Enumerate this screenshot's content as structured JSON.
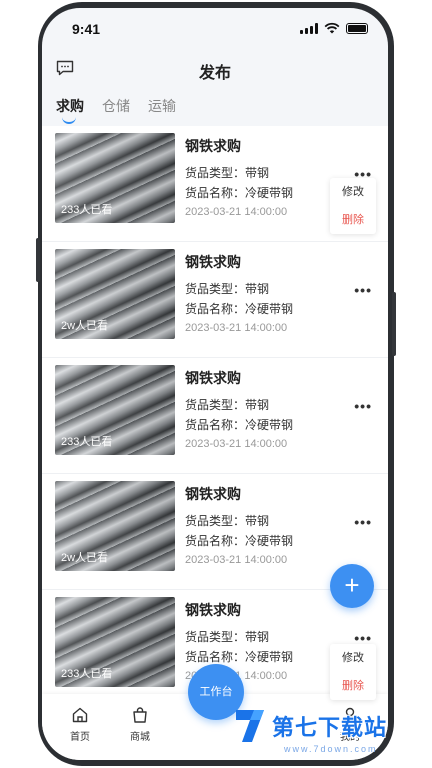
{
  "status": {
    "time": "9:41"
  },
  "header": {
    "title": "发布",
    "message_icon": "message-icon"
  },
  "tabs": [
    {
      "label": "求购",
      "active": true
    },
    {
      "label": "仓储",
      "active": false
    },
    {
      "label": "运输",
      "active": false
    }
  ],
  "posts": [
    {
      "title": "钢铁求购",
      "type": "货品类型：带钢",
      "name": "货品名称：冷硬带钢",
      "date": "2023-03-21  14:00:00",
      "views": "233人已看"
    },
    {
      "title": "钢铁求购",
      "type": "货品类型：带钢",
      "name": "货品名称：冷硬带钢",
      "date": "2023-03-21  14:00:00",
      "views": "2w人已看"
    },
    {
      "title": "钢铁求购",
      "type": "货品类型：带钢",
      "name": "货品名称：冷硬带钢",
      "date": "2023-03-21  14:00:00",
      "views": "233人已看"
    },
    {
      "title": "钢铁求购",
      "type": "货品类型：带钢",
      "name": "货品名称：冷硬带钢",
      "date": "2023-03-21  14:00:00",
      "views": "2w人已看"
    },
    {
      "title": "钢铁求购",
      "type": "货品类型：带钢",
      "name": "货品名称：冷硬带钢",
      "date": "2023-03-21  14:00:00",
      "views": "233人已看"
    }
  ],
  "more_label": "•••",
  "popup": {
    "edit": "修改",
    "delete": "删除"
  },
  "fab": {
    "icon": "plus-icon",
    "label": "+"
  },
  "tabbar": {
    "home": "首页",
    "mall": "商城",
    "workbench": "工作台",
    "mine": "我的"
  },
  "watermark": {
    "text": "第七下载站",
    "url": "www.7down.com"
  },
  "colors": {
    "accent": "#3d90f2",
    "danger": "#e8554e",
    "background": "#f4f6f9"
  }
}
